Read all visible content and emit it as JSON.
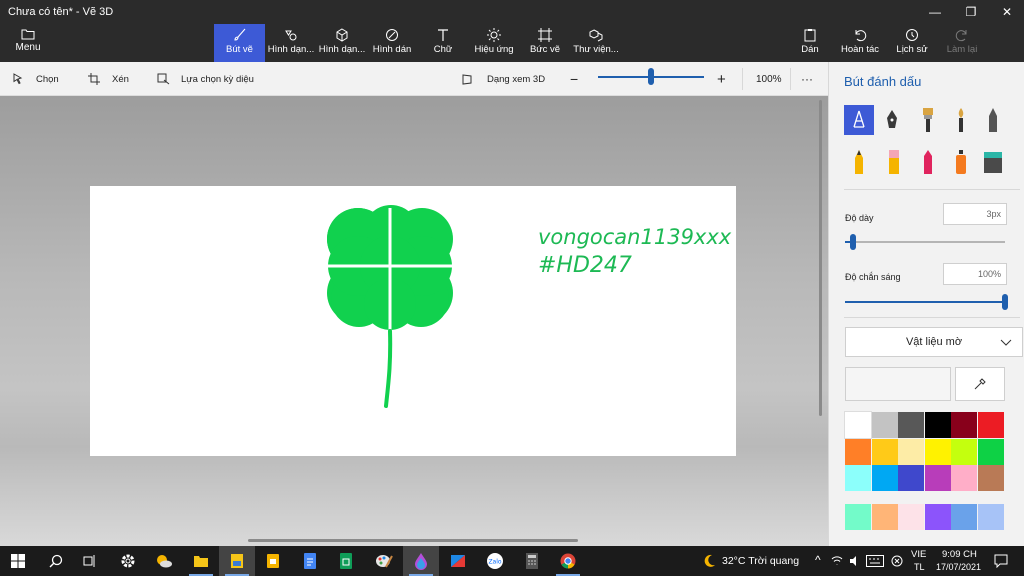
{
  "window": {
    "title": "Chưa có tên* - Vẽ 3D",
    "minimize_glyph": "—",
    "maximize_glyph": "❐",
    "close_glyph": "✕"
  },
  "menu": {
    "label": "Menu"
  },
  "tools": [
    {
      "label": "Bút vẽ",
      "icon": "brush-icon"
    },
    {
      "label": "Hình dạn...",
      "icon": "shapes-2d-icon"
    },
    {
      "label": "Hình dạn...",
      "icon": "cube-icon"
    },
    {
      "label": "Hình dán",
      "icon": "sticker-icon"
    },
    {
      "label": "Chữ",
      "icon": "text-icon"
    },
    {
      "label": "Hiệu ứng",
      "icon": "effects-icon"
    },
    {
      "label": "Bức vẽ",
      "icon": "canvas-icon"
    },
    {
      "label": "Thư viện...",
      "icon": "library-icon"
    }
  ],
  "actions": [
    {
      "label": "Dán",
      "icon": "paste-icon"
    },
    {
      "label": "Hoàn tác",
      "icon": "undo-icon"
    },
    {
      "label": "Lịch sử",
      "icon": "history-icon"
    },
    {
      "label": "Làm lại",
      "icon": "redo-icon"
    }
  ],
  "subtoolbar": {
    "select": "Chọn",
    "crop": "Xén",
    "magic_select": "Lựa chọn kỳ diệu",
    "view_3d": "Dạng xem 3D",
    "zoom_percent": "100%",
    "zoom_level": 0.5,
    "more_glyph": "···"
  },
  "canvas": {
    "handwriting_line1": "vongocan1139xxx",
    "handwriting_line2": "#HD247",
    "ink_color": "#1db954",
    "clover_color": "#11d14e"
  },
  "panel": {
    "title": "Bút đánh dấu",
    "thickness_label": "Độ dày",
    "thickness_value": "3px",
    "thickness_level": 0.02,
    "opacity_label": "Độ chắn sáng",
    "opacity_value": "100%",
    "opacity_level": 1.0,
    "material": "Vật liệu mờ",
    "brushes": [
      "marker-icon",
      "calligraphy-pen-icon",
      "oil-brush-icon",
      "watercolor-icon",
      "pixel-pen-icon",
      "pencil-icon",
      "eraser-icon",
      "crayon-icon",
      "spray-can-icon",
      "fill-bucket-icon"
    ],
    "palette": [
      "#ffffff",
      "#c3c3c3",
      "#585858",
      "#000000",
      "#88001b",
      "#ec1c24",
      "#ff7f27",
      "#ffca18",
      "#fdeca6",
      "#fff200",
      "#c4ff0e",
      "#0ed145",
      "#8cfffb",
      "#00a8f3",
      "#3f48cc",
      "#b83dba",
      "#ffaec8",
      "#b97a56",
      "#73fbc9",
      "#ffb577",
      "#fde2e8",
      "#8c54fb",
      "#6aa2ea",
      "#a7c3f7"
    ]
  },
  "taskbar": {
    "weather": "32°C  Trời quang",
    "lang": "VIE",
    "lang_sub": "TL",
    "time": "9:09 CH",
    "date": "17/07/2021",
    "apps": [
      "windows-start-icon",
      "search-icon",
      "task-view-icon",
      "settings-icon",
      "weather-widget-icon",
      "file-explorer-icon",
      "photos-app-icon",
      "slides-icon",
      "docs-icon",
      "sheets-icon",
      "paint-icon",
      "paint3d-icon",
      "snip-icon",
      "zalo-icon",
      "calculator-icon",
      "chrome-icon"
    ]
  }
}
